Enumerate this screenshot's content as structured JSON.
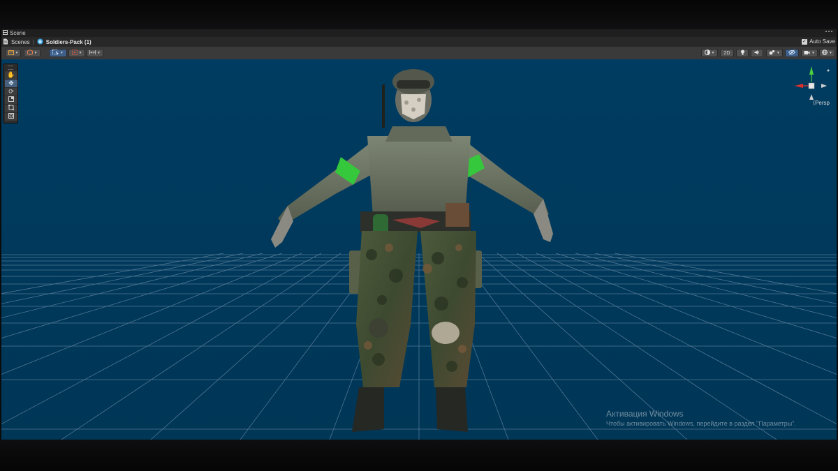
{
  "window": {
    "panel_title": "Scene",
    "breadcrumb": {
      "root": "Scenes",
      "current": "Soldiers-Pack (1)"
    },
    "auto_save": {
      "label": "Auto Save",
      "checked": true
    }
  },
  "toolbar": {
    "left_buttons": [
      "draw-mode",
      "render-mode",
      "transform-toggle",
      "snap-toggle",
      "grid-toggle"
    ],
    "right_buttons": [
      "shading",
      "2D",
      "lighting",
      "audio",
      "effects",
      "hidden-objects",
      "camera",
      "gizmos"
    ],
    "button_2d_label": "2D"
  },
  "tools": [
    "hand-tool",
    "move-tool",
    "rotate-tool",
    "scale-tool",
    "rect-tool",
    "transform-tool"
  ],
  "active_tool": "move-tool",
  "scene": {
    "view_label": "Persp",
    "background_color": "#003a5e",
    "grid_color": "#6a8aa6",
    "subject": "soldier character model in T-pose"
  },
  "activation": {
    "title": "Активация Windows",
    "subtitle": "Чтобы активировать Windows, перейдите в раздел \"Параметры\"."
  }
}
